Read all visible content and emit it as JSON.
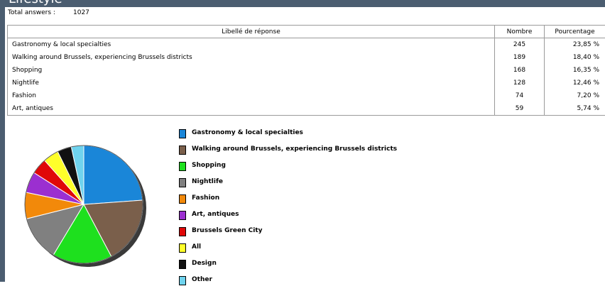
{
  "page": {
    "title": "Lifestyle"
  },
  "summary": {
    "total_label": "Total answers :",
    "total_value": "1027"
  },
  "table": {
    "headers": [
      "Libellé de réponse",
      "Nombre",
      "Pourcentage"
    ],
    "rows": [
      {
        "label": "Gastronomy & local specialties",
        "count": "245",
        "percent": "23,85 %"
      },
      {
        "label": "Walking around Brussels, experiencing Brussels districts",
        "count": "189",
        "percent": "18,40 %"
      },
      {
        "label": "Shopping",
        "count": "168",
        "percent": "16,35 %"
      },
      {
        "label": "Nightlife",
        "count": "128",
        "percent": "12,46 %"
      },
      {
        "label": "Fashion",
        "count": "74",
        "percent": "7,20 %"
      },
      {
        "label": "Art, antiques",
        "count": "59",
        "percent": "5,74 %"
      }
    ]
  },
  "chart_data": {
    "type": "pie",
    "labels": [
      "Gastronomy & local specialties",
      "Walking around Brussels, experiencing Brussels districts",
      "Shopping",
      "Nightlife",
      "Fashion",
      "Art, antiques",
      "Brussels Green City",
      "All",
      "Design",
      "Other"
    ],
    "values": [
      245,
      189,
      168,
      128,
      74,
      59,
      45,
      44,
      40,
      35
    ],
    "colors": [
      "#1a86d8",
      "#7a5f4b",
      "#1ee01e",
      "#808080",
      "#f2890a",
      "#9b2fd0",
      "#e00808",
      "#ffff2a",
      "#111111",
      "#6fd3ee"
    ],
    "legend": "right"
  }
}
